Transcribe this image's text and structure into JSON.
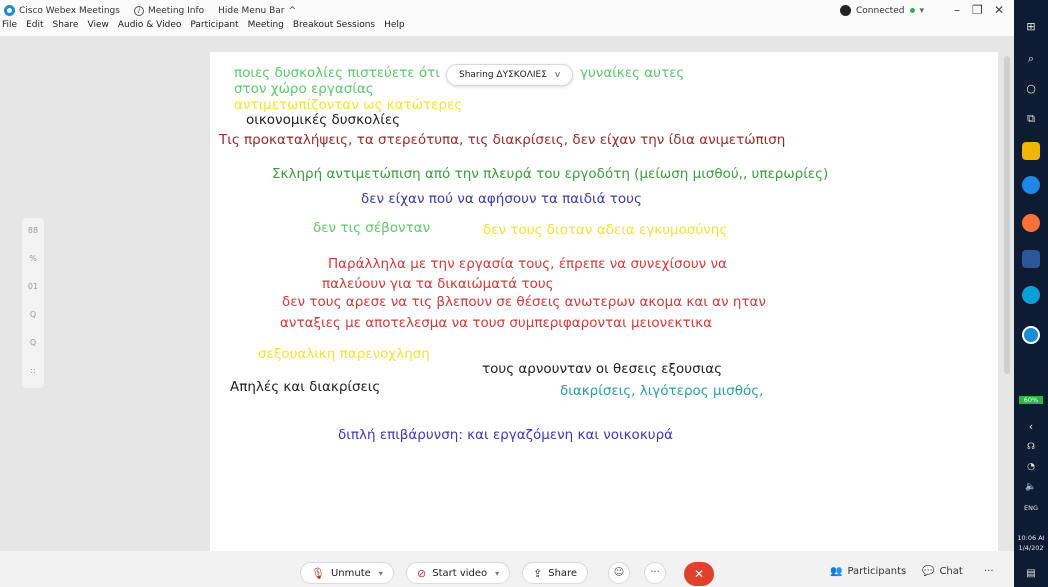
{
  "titlebar": {
    "app_name": "Cisco Webex Meetings",
    "meeting_info": "Meeting Info",
    "hide_menu": "Hide Menu Bar",
    "hide_menu_caret": "^",
    "connection_status": "Connected",
    "menu": [
      "File",
      "Edit",
      "Share",
      "View",
      "Audio & Video",
      "Participant",
      "Meeting",
      "Breakout Sessions",
      "Help"
    ]
  },
  "sharing": {
    "label": "Sharing ΔΥΣΚΟΛΙΕΣ",
    "caret": "v"
  },
  "whiteboard": {
    "lines": [
      {
        "text": "ποιες δυσκολίες πιστεύετε ότι",
        "color": "#5cc96a"
      },
      {
        "text": "γυναίκες αυτες",
        "color": "#5cc96a"
      },
      {
        "text": "στον χώρο εργασίας",
        "color": "#5cc96a"
      },
      {
        "text": "αντιμετωπίζονταν ως κατώτερες",
        "color": "#f2e33a"
      },
      {
        "text": "οικονομικές δυσκολίες",
        "color": "#222222"
      },
      {
        "text": "Τις προκαταλήψεις, τα στερεότυπα, τις διακρίσεις, δεν είχαν την ίδια ανιμετώπιση",
        "color": "#9b2a2a"
      },
      {
        "text": "Σκληρή αντιμετώπιση από την πλευρά του εργοδότη (μείωση μισθού,, υπερωρίες)",
        "color": "#3d9b3d"
      },
      {
        "text": "δεν είχαν πού να αφήσουν τα παιδιά τους",
        "color": "#3b3bb5"
      },
      {
        "text": "δεν τις σέβονταν",
        "color": "#5cc96a"
      },
      {
        "text": "δεν τους διοταν αδεια εγκυμοσύνης",
        "color": "#f2e33a"
      },
      {
        "text": "Παράλληλα με την εργασία τους, έπρεπε να συνεχίσουν να",
        "color": "#d13b3b"
      },
      {
        "text": "παλεύουν για τα δικαιώματά τους",
        "color": "#d13b3b"
      },
      {
        "text": "δεν τους αρεσε να τις βλεπουν σε θέσεις ανωτερων ακομα και αν ηταν",
        "color": "#d13b3b"
      },
      {
        "text": "ανταξιες με αποτελεσμα να τουσ συμπεριφαρονται μειονεκτικα",
        "color": "#d13b3b"
      },
      {
        "text": "σεξουαλικη παρενοχληση",
        "color": "#f2e33a"
      },
      {
        "text": "τους αρνουνταν οι θεσεις εξουσιας",
        "color": "#222222"
      },
      {
        "text": "Απηλές και διακρίσεις",
        "color": "#222222"
      },
      {
        "text": "διακρίσεις, λιγότερος μισθός,",
        "color": "#2aa198"
      },
      {
        "text": "διπλή επιβάρυνση: και εργαζόμενη και νοικοκυρά",
        "color": "#3b3bb5"
      }
    ]
  },
  "left_tools": [
    "88",
    "%",
    "01",
    "Q",
    "Q",
    "::"
  ],
  "bottombar": {
    "unmute": "Unmute",
    "start_video": "Start video",
    "share": "Share",
    "more": "···",
    "participants": "Participants",
    "chat": "Chat",
    "more2": "···"
  },
  "taskbar": {
    "battery": "60%",
    "lang": "ENG",
    "time": "10:06 AI",
    "date": "1/4/202"
  },
  "colors": {
    "accent": "#1a8cd8",
    "end_call": "#e0412b",
    "connected": "#2db34a",
    "taskbar": "#0d1b33"
  }
}
